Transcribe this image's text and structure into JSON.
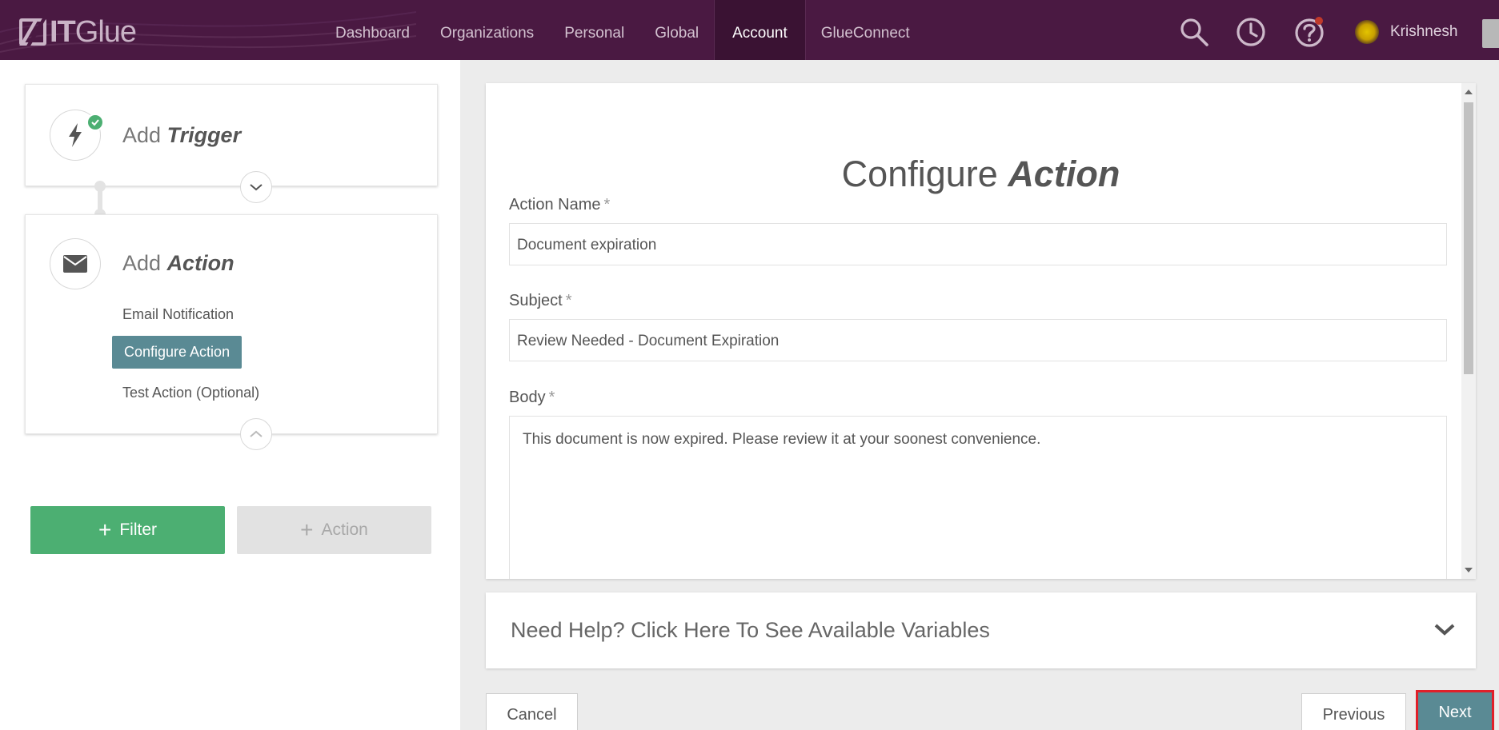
{
  "brand": {
    "logo_text_bold": "IT",
    "logo_text_light": "Glue"
  },
  "nav": {
    "items": [
      {
        "label": "Dashboard"
      },
      {
        "label": "Organizations"
      },
      {
        "label": "Personal"
      },
      {
        "label": "Global"
      },
      {
        "label": "Account"
      },
      {
        "label": "GlueConnect"
      }
    ],
    "active": "Account"
  },
  "header_icons": [
    "search-icon",
    "history-icon",
    "help-icon"
  ],
  "user": {
    "name": "Krishnesh"
  },
  "workflow": {
    "trigger": {
      "prefix": "Add",
      "emphasis": "Trigger",
      "status": "complete"
    },
    "action": {
      "prefix": "Add",
      "emphasis": "Action",
      "steps": [
        {
          "label": "Email Notification"
        },
        {
          "label": "Configure Action"
        },
        {
          "label": "Test Action (Optional)"
        }
      ],
      "active_step": "Configure Action"
    },
    "filter_button": "Filter",
    "action_button": "Action"
  },
  "form": {
    "title_light": "Configure",
    "title_bold": "Action",
    "action_name": {
      "label": "Action Name",
      "required": "*",
      "value": "Document expiration"
    },
    "subject": {
      "label": "Subject",
      "required": "*",
      "value": "Review Needed - Document Expiration"
    },
    "body": {
      "label": "Body",
      "required": "*",
      "value": "This document is now expired. Please review it at your soonest convenience."
    }
  },
  "help": {
    "text": "Need Help? Click Here To See Available Variables"
  },
  "footer": {
    "cancel": "Cancel",
    "previous": "Previous",
    "next": "Next"
  },
  "colors": {
    "topbar": "#4a1942",
    "accent_teal": "#5a8a94",
    "success_green": "#4caf72",
    "highlight_red": "#e0202a"
  }
}
